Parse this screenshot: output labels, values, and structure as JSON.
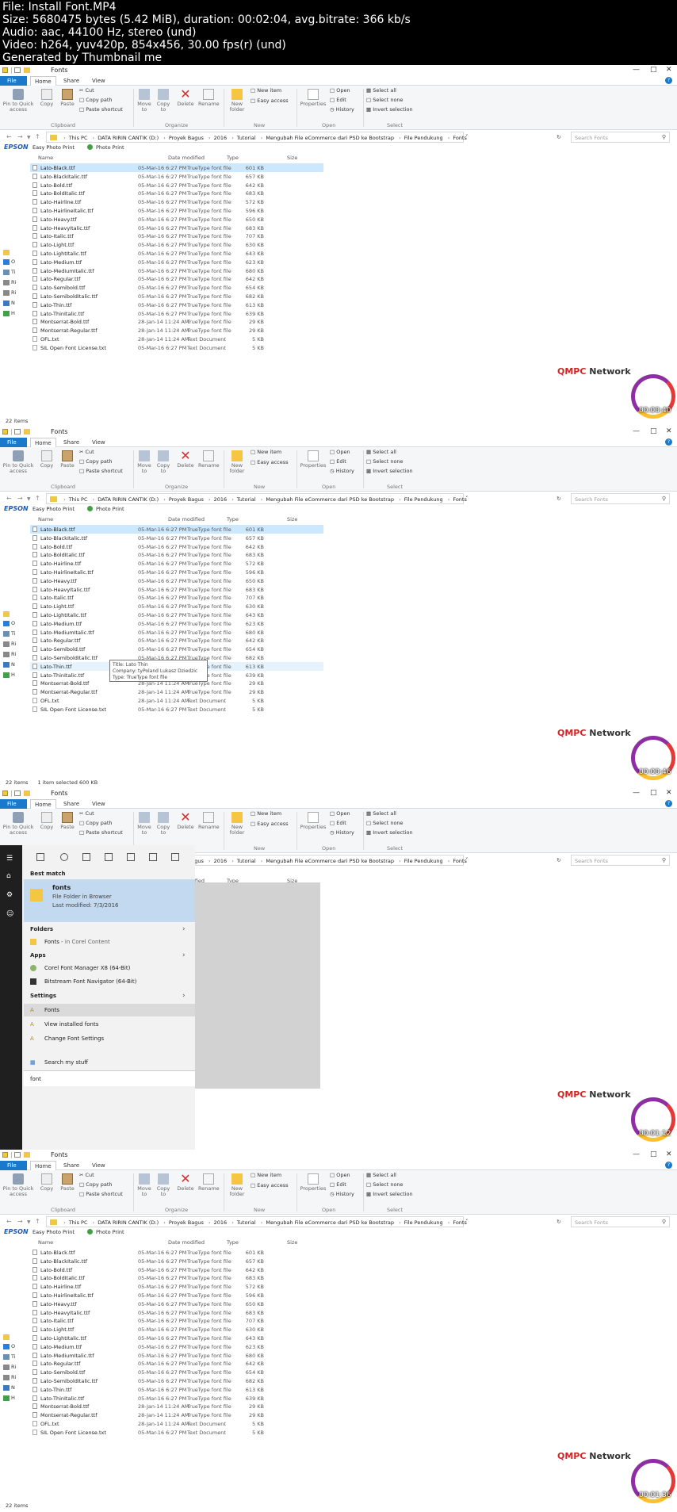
{
  "header": {
    "lines": [
      "File: Install Font.MP4",
      "Size: 5680475 bytes (5.42 MiB), duration: 00:02:04, avg.bitrate: 366 kb/s",
      "Audio: aac, 44100 Hz, stereo (und)",
      "Video: h264, yuv420p, 854x456, 30.00 fps(r) (und)",
      "Generated by Thumbnail me"
    ]
  },
  "explorer": {
    "window_title": "Fonts",
    "tabs": {
      "file": "File",
      "home": "Home",
      "share": "Share",
      "view": "View"
    },
    "ribbon": {
      "pin": "Pin to Quick access",
      "copy": "Copy",
      "paste": "Paste",
      "cut": "Cut",
      "copy_path": "Copy path",
      "paste_shortcut": "Paste shortcut",
      "move_to": "Move to",
      "copy_to": "Copy to",
      "delete": "Delete",
      "rename": "Rename",
      "new_folder": "New folder",
      "new_item": "New item",
      "easy_access": "Easy access",
      "properties": "Properties",
      "open": "Open",
      "edit": "Edit",
      "history": "History",
      "select_all": "Select all",
      "select_none": "Select none",
      "invert_selection": "Invert selection",
      "groups": {
        "clipboard": "Clipboard",
        "organize": "Organize",
        "new": "New",
        "open": "Open",
        "select": "Select"
      }
    },
    "breadcrumb": [
      "This PC",
      "DATA RIRIN CANTIK (D:)",
      "Proyek Bagus",
      "2016",
      "Tutorial",
      "Mengubah File eCommerce dari PSD ke Bootstrap",
      "File Pendukung",
      "Fonts"
    ],
    "search_placeholder": "Search Fonts",
    "favorites": {
      "epson": "EPSON",
      "easy_photo": "Easy Photo Print",
      "photo_print": "Photo Print"
    },
    "nav_items": [
      "O",
      "Ti",
      "Ri",
      "Ri",
      "N",
      "H"
    ],
    "columns": {
      "name": "Name",
      "date": "Date modified",
      "type": "Type",
      "size": "Size"
    },
    "files": [
      {
        "name": "Lato-Black.ttf",
        "date": "05-Mar-16 6:27 PM",
        "type": "TrueType font file",
        "size": "601 KB"
      },
      {
        "name": "Lato-BlackItalic.ttf",
        "date": "05-Mar-16 6:27 PM",
        "type": "TrueType font file",
        "size": "657 KB"
      },
      {
        "name": "Lato-Bold.ttf",
        "date": "05-Mar-16 6:27 PM",
        "type": "TrueType font file",
        "size": "642 KB"
      },
      {
        "name": "Lato-BoldItalic.ttf",
        "date": "05-Mar-16 6:27 PM",
        "type": "TrueType font file",
        "size": "683 KB"
      },
      {
        "name": "Lato-Hairline.ttf",
        "date": "05-Mar-16 6:27 PM",
        "type": "TrueType font file",
        "size": "572 KB"
      },
      {
        "name": "Lato-HairlineItalic.ttf",
        "date": "05-Mar-16 6:27 PM",
        "type": "TrueType font file",
        "size": "596 KB"
      },
      {
        "name": "Lato-Heavy.ttf",
        "date": "05-Mar-16 6:27 PM",
        "type": "TrueType font file",
        "size": "650 KB"
      },
      {
        "name": "Lato-HeavyItalic.ttf",
        "date": "05-Mar-16 6:27 PM",
        "type": "TrueType font file",
        "size": "683 KB"
      },
      {
        "name": "Lato-Italic.ttf",
        "date": "05-Mar-16 6:27 PM",
        "type": "TrueType font file",
        "size": "707 KB"
      },
      {
        "name": "Lato-Light.ttf",
        "date": "05-Mar-16 6:27 PM",
        "type": "TrueType font file",
        "size": "630 KB"
      },
      {
        "name": "Lato-LightItalic.ttf",
        "date": "05-Mar-16 6:27 PM",
        "type": "TrueType font file",
        "size": "643 KB"
      },
      {
        "name": "Lato-Medium.ttf",
        "date": "05-Mar-16 6:27 PM",
        "type": "TrueType font file",
        "size": "623 KB"
      },
      {
        "name": "Lato-MediumItalic.ttf",
        "date": "05-Mar-16 6:27 PM",
        "type": "TrueType font file",
        "size": "680 KB"
      },
      {
        "name": "Lato-Regular.ttf",
        "date": "05-Mar-16 6:27 PM",
        "type": "TrueType font file",
        "size": "642 KB"
      },
      {
        "name": "Lato-Semibold.ttf",
        "date": "05-Mar-16 6:27 PM",
        "type": "TrueType font file",
        "size": "654 KB"
      },
      {
        "name": "Lato-SemiboldItalic.ttf",
        "date": "05-Mar-16 6:27 PM",
        "type": "TrueType font file",
        "size": "682 KB"
      },
      {
        "name": "Lato-Thin.ttf",
        "date": "05-Mar-16 6:27 PM",
        "type": "TrueType font file",
        "size": "613 KB"
      },
      {
        "name": "Lato-ThinItalic.ttf",
        "date": "05-Mar-16 6:27 PM",
        "type": "TrueType font file",
        "size": "639 KB"
      },
      {
        "name": "Montserrat-Bold.ttf",
        "date": "28-Jan-14 11:24 AM",
        "type": "TrueType font file",
        "size": "29 KB"
      },
      {
        "name": "Montserrat-Regular.ttf",
        "date": "28-Jan-14 11:24 AM",
        "type": "TrueType font file",
        "size": "29 KB"
      },
      {
        "name": "OFL.txt",
        "date": "28-Jan-14 11:24 AM",
        "type": "Text Document",
        "size": "5 KB"
      },
      {
        "name": "SIL Open Font License.txt",
        "date": "05-Mar-16 6:27 PM",
        "type": "Text Document",
        "size": "5 KB"
      }
    ],
    "status_items": "22 items",
    "status_selected": "1 item selected  600 KB"
  },
  "tooltip": {
    "title": "Title: Lato Thin",
    "company": "Company: tyPoland Lukasz Dziedzic",
    "type": "Type: TrueType font file"
  },
  "start_menu": {
    "best_match": "Best match",
    "best_name": "fonts",
    "best_type": "File Folder in Browser",
    "best_modified": "Last modified: 7/3/2016",
    "folders": "Folders",
    "folder_item": "Fonts",
    "folder_item_loc": "- in Corel Content",
    "apps": "Apps",
    "app1": "Corel Font Manager X8 (64-Bit)",
    "app2": "Bitstream Font Navigator (64-Bit)",
    "settings": "Settings",
    "set1": "Fonts",
    "set2": "View installed fonts",
    "set3": "Change Font Settings",
    "search_stuff": "Search my stuff",
    "query": "font"
  },
  "branding": {
    "network": "QMPC",
    "network_suffix": "Network"
  },
  "timestamps": [
    "00:00:40",
    "00:00:46",
    "00:01:12",
    "00:01:36"
  ]
}
